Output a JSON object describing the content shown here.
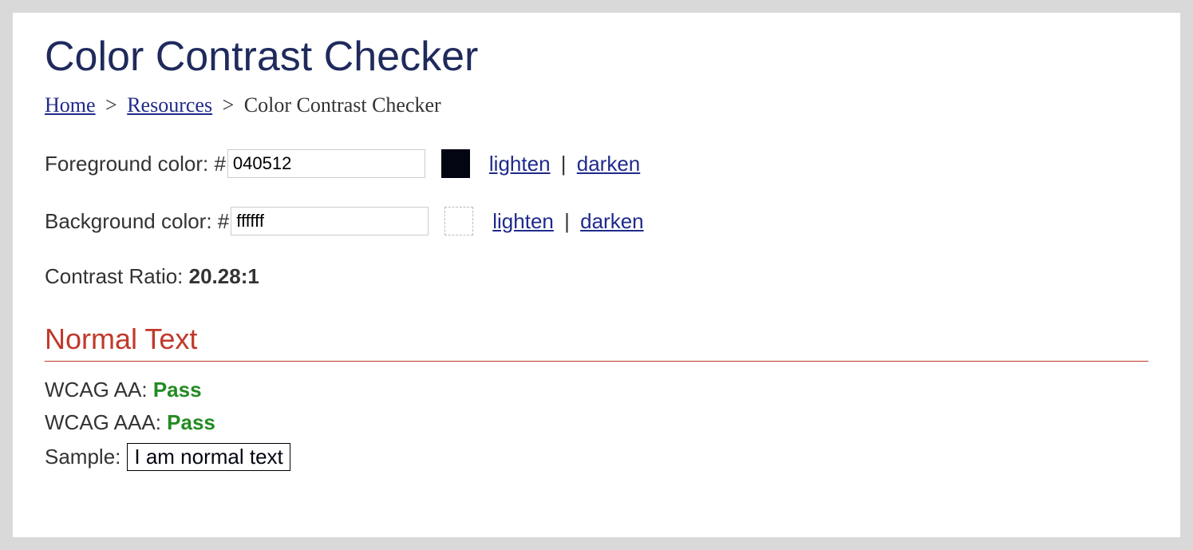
{
  "page_title": "Color Contrast Checker",
  "breadcrumb": {
    "home": "Home",
    "resources": "Resources",
    "current": "Color Contrast Checker"
  },
  "foreground": {
    "label": "Foreground color: #",
    "value": "040512",
    "lighten": "lighten",
    "darken": "darken"
  },
  "background": {
    "label": "Background color: #",
    "value": "ffffff",
    "lighten": "lighten",
    "darken": "darken"
  },
  "contrast": {
    "label": "Contrast Ratio: ",
    "ratio": "20.28:1"
  },
  "normal_text": {
    "heading": "Normal Text",
    "wcag_aa_label": "WCAG AA: ",
    "wcag_aa_result": "Pass",
    "wcag_aaa_label": "WCAG AAA: ",
    "wcag_aaa_result": "Pass",
    "sample_label": "Sample:",
    "sample_text": "I am normal text"
  },
  "separators": {
    "gt": ">",
    "pipe": "|"
  }
}
